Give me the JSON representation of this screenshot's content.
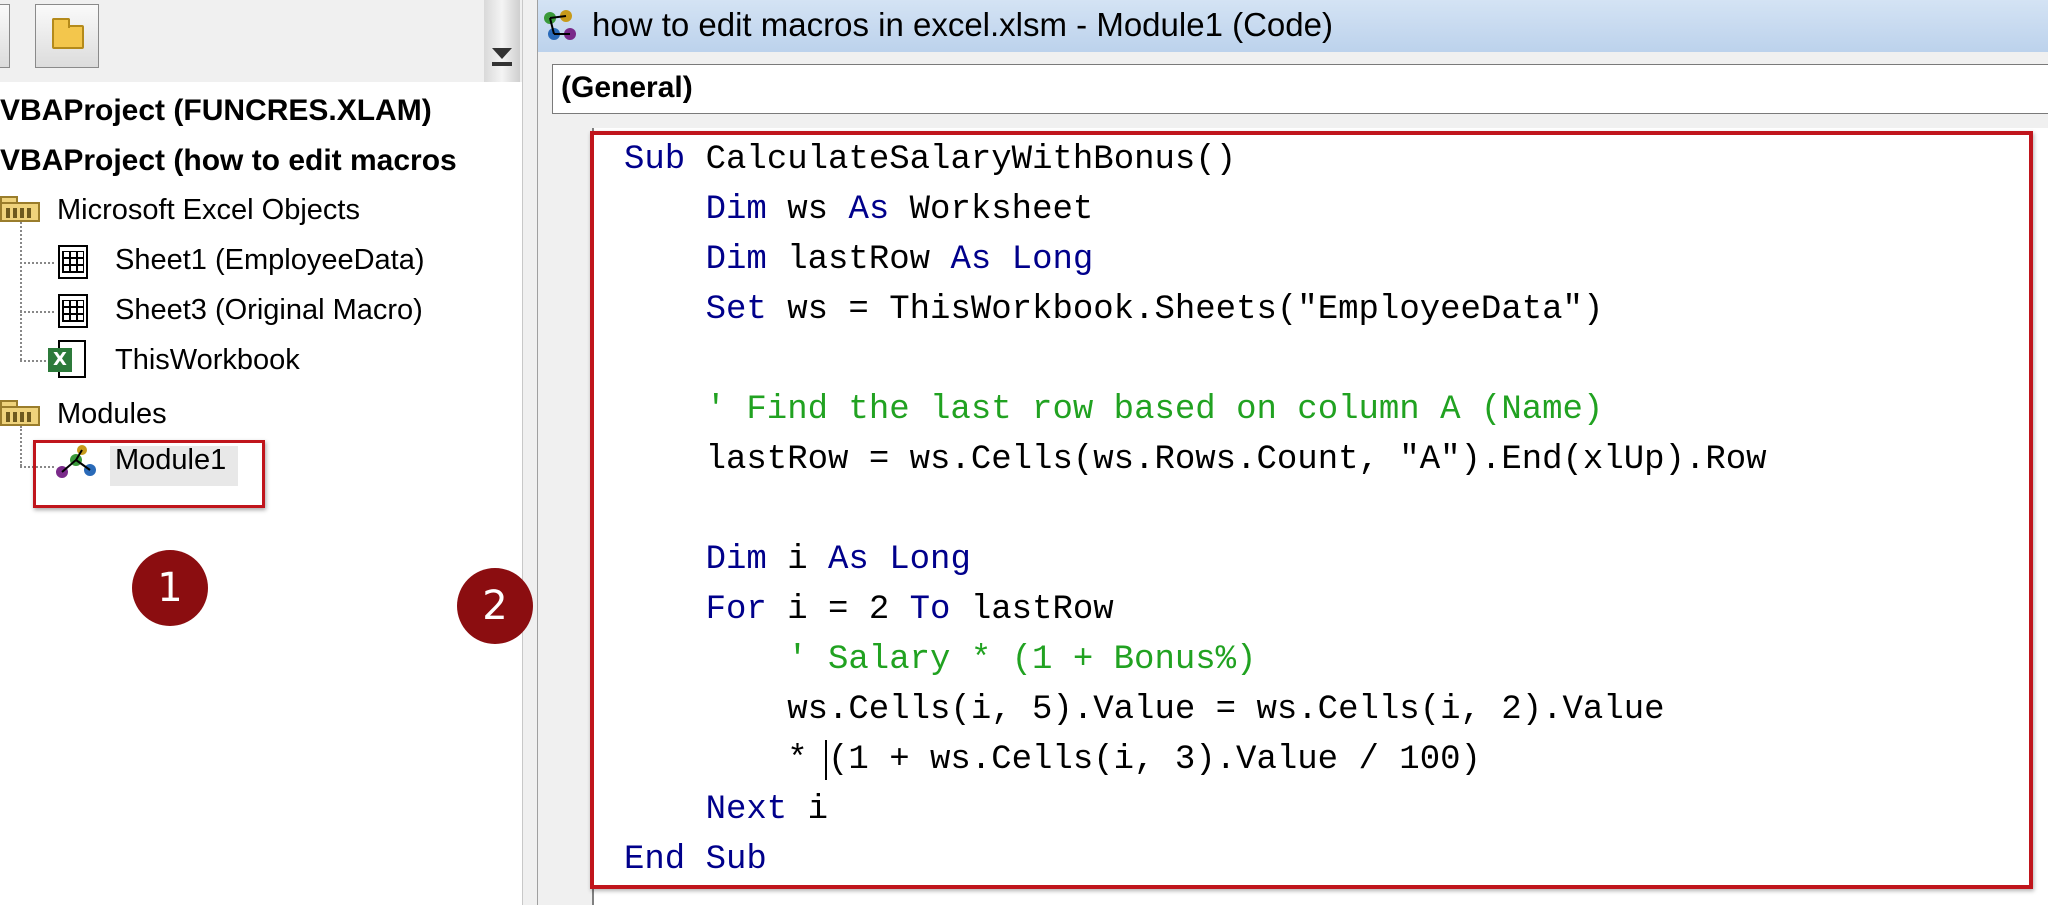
{
  "window_title": "how to edit macros in excel.xlsm - Module1 (Code)",
  "object_combo": "(General)",
  "project_tree": {
    "projects": [
      "VBAProject (FUNCRES.XLAM)",
      "VBAProject (how to edit macros"
    ],
    "folders": {
      "excel_objects": "Microsoft Excel Objects",
      "modules": "Modules"
    },
    "excel_objects": [
      "Sheet1 (EmployeeData)",
      "Sheet3 (Original Macro)",
      "ThisWorkbook"
    ],
    "modules": [
      "Module1"
    ]
  },
  "badges": {
    "one": "1",
    "two": "2"
  },
  "code": {
    "lines": [
      {
        "indent": "",
        "segments": [
          {
            "k": "kw",
            "t": "Sub"
          },
          {
            "k": "tx",
            "t": " CalculateSalaryWithBonus()"
          }
        ]
      },
      {
        "indent": "    ",
        "segments": [
          {
            "k": "kw",
            "t": "Dim"
          },
          {
            "k": "tx",
            "t": " ws "
          },
          {
            "k": "kw",
            "t": "As"
          },
          {
            "k": "tx",
            "t": " Worksheet"
          }
        ]
      },
      {
        "indent": "    ",
        "segments": [
          {
            "k": "kw",
            "t": "Dim"
          },
          {
            "k": "tx",
            "t": " lastRow "
          },
          {
            "k": "kw",
            "t": "As"
          },
          {
            "k": "tx",
            "t": " "
          },
          {
            "k": "kw",
            "t": "Long"
          }
        ]
      },
      {
        "indent": "    ",
        "segments": [
          {
            "k": "kw",
            "t": "Set"
          },
          {
            "k": "tx",
            "t": " ws = ThisWorkbook.Sheets(\"EmployeeData\")"
          }
        ]
      },
      {
        "indent": "",
        "segments": []
      },
      {
        "indent": "    ",
        "segments": [
          {
            "k": "cm",
            "t": "' Find the last row based on column A (Name)"
          }
        ]
      },
      {
        "indent": "    ",
        "segments": [
          {
            "k": "tx",
            "t": "lastRow = ws.Cells(ws.Rows.Count, \"A\").End(xlUp).Row"
          }
        ]
      },
      {
        "indent": "",
        "segments": []
      },
      {
        "indent": "    ",
        "segments": [
          {
            "k": "kw",
            "t": "Dim"
          },
          {
            "k": "tx",
            "t": " i "
          },
          {
            "k": "kw",
            "t": "As"
          },
          {
            "k": "tx",
            "t": " "
          },
          {
            "k": "kw",
            "t": "Long"
          }
        ]
      },
      {
        "indent": "    ",
        "segments": [
          {
            "k": "kw",
            "t": "For"
          },
          {
            "k": "tx",
            "t": " i = 2 "
          },
          {
            "k": "kw",
            "t": "To"
          },
          {
            "k": "tx",
            "t": " lastRow"
          }
        ]
      },
      {
        "indent": "        ",
        "segments": [
          {
            "k": "cm",
            "t": "' Salary * (1 + Bonus%)"
          }
        ]
      },
      {
        "indent": "        ",
        "segments": [
          {
            "k": "tx",
            "t": "ws.Cells(i, 5).Value = ws.Cells(i, 2).Value"
          }
        ]
      },
      {
        "indent": "        ",
        "segments": [
          {
            "k": "tx",
            "t": "* (1 + ws.Cells(i, 3).Value / 100)"
          }
        ]
      },
      {
        "indent": "    ",
        "segments": [
          {
            "k": "kw",
            "t": "Next"
          },
          {
            "k": "tx",
            "t": " i"
          }
        ]
      },
      {
        "indent": "",
        "segments": [
          {
            "k": "kw",
            "t": "End"
          },
          {
            "k": "tx",
            "t": " "
          },
          {
            "k": "kw",
            "t": "Sub"
          }
        ]
      }
    ]
  },
  "colors": {
    "keyword": "#00008b",
    "comment": "#21a221",
    "text": "#000000",
    "highlight_border": "#c0151c",
    "badge": "#8b0d10"
  },
  "icons": {
    "toolbar_button": "folder-icon",
    "folder": "folder-icon",
    "sheet": "worksheet-icon",
    "workbook": "excel-workbook-icon",
    "module": "module-icon",
    "title": "vba-code-icon"
  }
}
